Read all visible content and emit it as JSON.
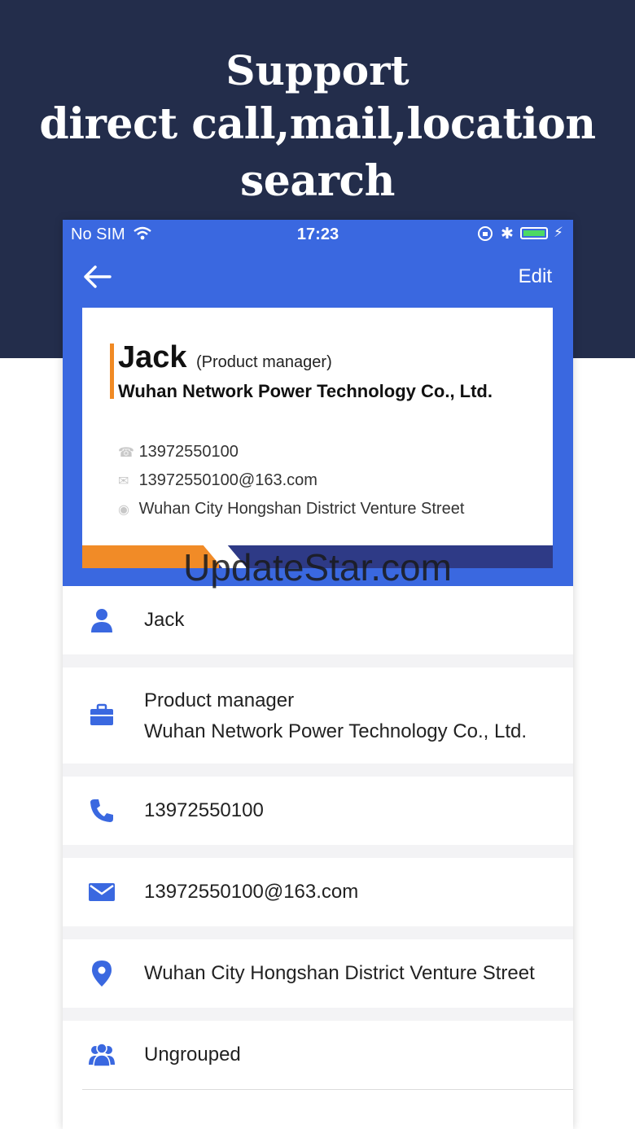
{
  "headline": {
    "line1": "Support",
    "line2": "direct call,mail,location search"
  },
  "status_bar": {
    "carrier": "No SIM",
    "time": "17:23"
  },
  "nav": {
    "edit_label": "Edit"
  },
  "card": {
    "name": "Jack",
    "title": "(Product manager)",
    "company": "Wuhan Network Power Technology Co., Ltd.",
    "phone": "13972550100",
    "email": "13972550100@163.com",
    "address": "Wuhan City Hongshan District Venture Street"
  },
  "details": {
    "name": "Jack",
    "position": "Product manager",
    "company": "Wuhan Network Power Technology Co., Ltd.",
    "phone": "13972550100",
    "email": "13972550100@163.com",
    "address": "Wuhan City Hongshan District Venture Street",
    "group": "Ungrouped"
  },
  "watermark": "UpdateStar.com",
  "colors": {
    "brand_blue": "#3a68e0",
    "dark_band": "#232d4b",
    "accent_orange": "#f08a24",
    "stripe_navy": "#2e3a86"
  }
}
